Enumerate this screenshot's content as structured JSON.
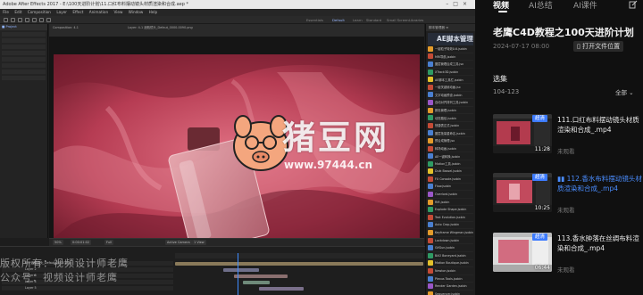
{
  "ae": {
    "title_bar": "Adobe After Effects 2017 - E:\\100天进阶计划\\11.口红布料摆动镜头材质渲染和合成.aep *",
    "menu": [
      "File",
      "Edit",
      "Composition",
      "Layer",
      "Effect",
      "Animation",
      "View",
      "Window",
      "Help"
    ],
    "workspaces": [
      "Essentials",
      "Default",
      "Learn",
      "Standard",
      "Small Screen",
      "Libraries"
    ],
    "comp_tab": "Composition: 4-1",
    "comp_tab2": "Layer: 4-1 酒瓶镜头_Defaut_0000-0090.png",
    "viewer": {
      "zoom": "50%",
      "time": "0:00:01:02",
      "res": "Full",
      "camera": "Active Camera",
      "view": "1 View"
    },
    "script_panel": {
      "header": "脚本管理器 ≡",
      "title": "AE脚本管理器",
      "items": [
        "一键粒子特效0.6.jsxbin",
        "MRi导航.jsxbin",
        "图层管理合成工具.jsx",
        "XTrack3D.jsxbin",
        "AE脚本工具栏.jsxbin",
        "一键关键帧动画.jsx",
        "文字动画预设.jsxbin",
        "自动对齐排列工具.jsxbin",
        "颜色管理.jsxbin",
        "动态路径.jsxbin",
        "快捷表达式.jsxbin",
        "图层批量重命名.jsxbin",
        "预合成管理.jsx",
        "转场动画.jsxbin",
        "AE一键转换.jsxbin",
        "Motion工具.jsxbin",
        "Duik Bassel.jsxbin",
        "FX Console.jsxbin",
        "Flow.jsxbin",
        "Overlord.jsxbin",
        "Rift.jsxbin",
        "Explode Shape.jsxbin",
        "Text Evolution.jsxbin",
        "Auto Crop.jsxbin",
        "Keyframe Wingman.jsxbin",
        "Lockdown.jsxbin",
        "GifGun.jsxbin",
        "BAO Boneyard.jsxbin",
        "Motion Boutique.jsxbin",
        "Newton.jsxbin",
        "Plexus Tools.jsxbin",
        "Render Garden.jsxbin",
        "Sequencer.jsxbin"
      ],
      "icon_colors": [
        "#e39b2b",
        "#c44b36",
        "#4a7fcf",
        "#2f9a63",
        "#e3c12b",
        "#c44b36",
        "#4a7fcf",
        "#9a57c7",
        "#e39b2b",
        "#2f9a63",
        "#c44b36",
        "#4a7fcf"
      ]
    },
    "timeline": {
      "layers": [
        {
          "name": "4-1 酒瓶镜头_Defaut_0000.png",
          "bar_color": "#8a7a5a"
        },
        {
          "name": "Layer 2",
          "bar_color": "#6f6f8a"
        },
        {
          "name": "Layer 3",
          "bar_color": "#8a6f6f"
        },
        {
          "name": "Layer 4",
          "bar_color": "#6f8a7a"
        },
        {
          "name": "Layer 5",
          "bar_color": "#7a6f8a"
        }
      ]
    }
  },
  "watermark": {
    "brand_cn": "猪豆网",
    "url": "www.97444.cn",
    "copyright_line1": "版权所有：视频设计师老鹰",
    "copyright_line2": "公众号：视频设计师老鹰"
  },
  "sidebar": {
    "tabs": [
      "视频",
      "AI总结",
      "AI课件"
    ],
    "course_title": "老鹰C4D教程之100天进阶计划",
    "course_date": "2024-07-17 08:00",
    "open_files_button": "打开文件位置",
    "selection_label": "选集",
    "range_label": "104-123",
    "all_label": "全部",
    "episodes": [
      {
        "title": "111.口红布料摆动镜头材质渲染和合成_.mp4",
        "badge": "超清",
        "duration": "11:28",
        "status": "未观看",
        "playing": false
      },
      {
        "title": "112.香水布料摆动镜头材质渲染和合成_.mp4",
        "badge": "超清",
        "duration": "10:25",
        "status": "未观看",
        "playing": true
      },
      {
        "title": "113.香水肿落在丝绸布料渲染和合成_.mp4",
        "badge": "超清",
        "duration": "06:44",
        "status": "未观看",
        "playing": false
      }
    ]
  },
  "colors": {
    "accent": "#3d7bff",
    "playing": "#4a8dff",
    "fabric": "#c4485f",
    "bg": "#101010"
  }
}
